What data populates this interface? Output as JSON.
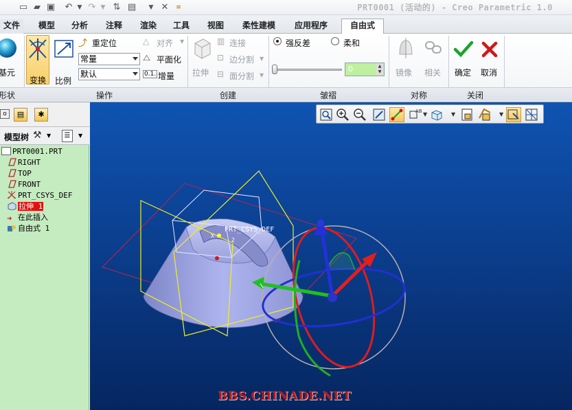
{
  "window": {
    "title": "PRT0001 (活动的) - Creo Parametric 1.0"
  },
  "ribbon_tabs": [
    {
      "label": "文件",
      "active": false
    },
    {
      "label": "模型",
      "active": false
    },
    {
      "label": "分析",
      "active": false
    },
    {
      "label": "注释",
      "active": false
    },
    {
      "label": "渲染",
      "active": false
    },
    {
      "label": "工具",
      "active": false
    },
    {
      "label": "视图",
      "active": false
    },
    {
      "label": "柔性建模",
      "active": false
    },
    {
      "label": "应用程序",
      "active": false
    },
    {
      "label": "自由式",
      "active": true
    }
  ],
  "ribbon": {
    "shape": {
      "primitive_label": "基元",
      "group_label": "形状"
    },
    "operations": {
      "group_label": "操作",
      "transform_label": "变换",
      "scale_label": "比例",
      "reposition_label": "重定位",
      "mode_value": "常量",
      "default_value": "默认",
      "align_label": "对齐",
      "flatten_label": "平面化",
      "increment_prefix": "0.1.",
      "increment_label": "增量"
    },
    "create": {
      "group_label": "创建",
      "extrude_label": "拉伸",
      "connect_label": "连接",
      "edge_split_label": "边分割",
      "face_split_label": "面分割"
    },
    "crease": {
      "group_label": "皱褶",
      "strong_label": "强反差",
      "soft_label": "柔和",
      "value": "0",
      "selected": "strong"
    },
    "symmetry": {
      "group_label": "对称",
      "mirror_label": "镜像",
      "related_label": "相关"
    },
    "close": {
      "group_label": "关闭",
      "ok_label": "确定",
      "cancel_label": "取消"
    }
  },
  "model_tree": {
    "header_label": "模型树",
    "items": [
      {
        "label": "PRT0001.PRT",
        "icon": "part-icon",
        "highlight": false
      },
      {
        "label": "RIGHT",
        "icon": "datum-plane-icon",
        "highlight": false
      },
      {
        "label": "TOP",
        "icon": "datum-plane-icon",
        "highlight": false
      },
      {
        "label": "FRONT",
        "icon": "datum-plane-icon",
        "highlight": false
      },
      {
        "label": "PRT_CSYS_DEF",
        "icon": "csys-icon",
        "highlight": false
      },
      {
        "label": "拉伸 1",
        "icon": "extrude-icon",
        "highlight": true
      },
      {
        "label": "在此插入",
        "icon": "insert-arrow-icon",
        "highlight": false
      },
      {
        "label": "自由式 1",
        "icon": "freestyle-icon",
        "highlight": false
      }
    ]
  },
  "viewport": {
    "csys_label": "PRT_CSYS_DEF",
    "axis_label_x": "X",
    "axis_label_z": "2",
    "watermark": "BBS.CHINADE.NET"
  },
  "colors": {
    "viewport_top": "#0f54b2",
    "viewport_bottom": "#062660",
    "model_tree_bg": "#c5ebc0",
    "ok": "#1aa52c",
    "cancel": "#d01818"
  }
}
